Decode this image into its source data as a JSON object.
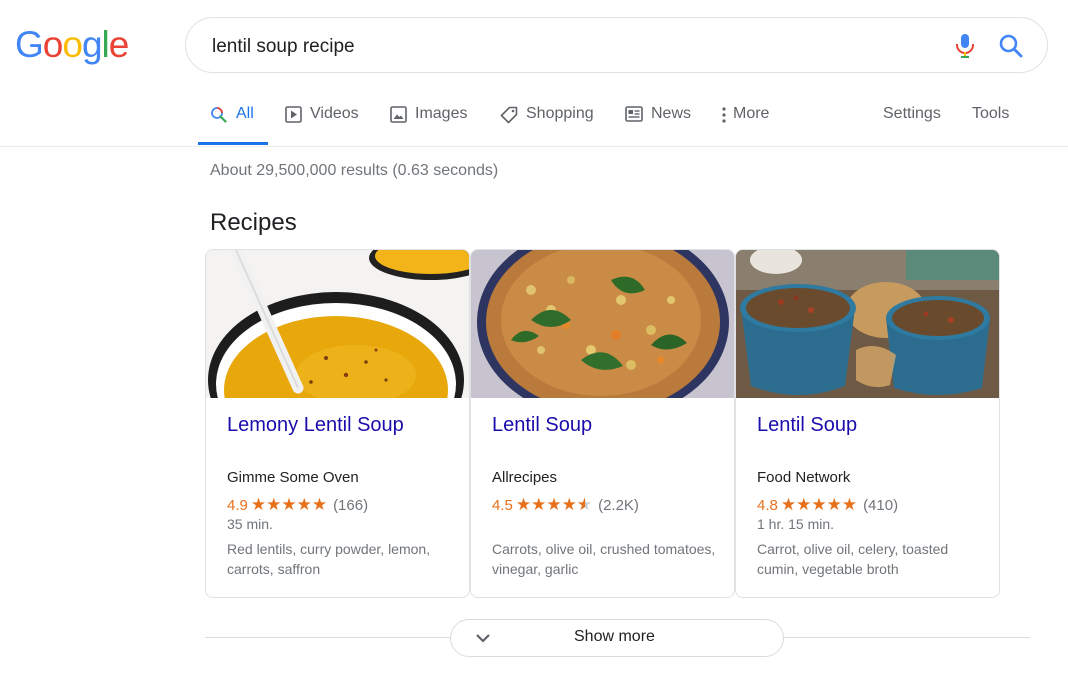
{
  "logo": {
    "letters": [
      "G",
      "o",
      "o",
      "g",
      "l",
      "e"
    ],
    "colors": [
      "#4285F4",
      "#EA4335",
      "#FBBC05",
      "#4285F4",
      "#34A853",
      "#EA4335"
    ]
  },
  "search": {
    "query": "lentil soup recipe",
    "mic_icon": "mic-icon",
    "search_icon": "search-icon"
  },
  "tabs": [
    {
      "label": "All",
      "icon": "search-icon",
      "active": true
    },
    {
      "label": "Videos",
      "icon": "play-icon"
    },
    {
      "label": "Images",
      "icon": "image-icon"
    },
    {
      "label": "Shopping",
      "icon": "tag-icon"
    },
    {
      "label": "News",
      "icon": "news-icon"
    },
    {
      "label": "More",
      "icon": "more-vert-icon"
    },
    {
      "label": "Settings"
    },
    {
      "label": "Tools"
    }
  ],
  "results": {
    "stats": "About 29,500,000 results (0.63 seconds)"
  },
  "recipes": {
    "section_title": "Recipes",
    "cards": [
      {
        "title": "Lemony Lentil Soup",
        "source": "Gimme Some Oven",
        "rating": "4.9",
        "stars": "★★★★★",
        "reviews": "(166)",
        "time": "35 min.",
        "ingredients": "Red lentils, curry powder, lemon, carrots, saffron"
      },
      {
        "title": "Lentil Soup",
        "source": "Allrecipes",
        "rating": "4.5",
        "stars": "★★★★★",
        "reviews": "(2.2K)",
        "time": "",
        "ingredients": "Carrots, olive oil, crushed tomatoes, vinegar, garlic"
      },
      {
        "title": "Lentil Soup",
        "source": "Food Network",
        "rating": "4.8",
        "stars": "★★★★★",
        "reviews": "(410)",
        "time": "1 hr. 15 min.",
        "ingredients": "Carrot, olive oil, celery, toasted cumin, vegetable broth"
      }
    ]
  },
  "show_more": {
    "label": "Show more"
  },
  "colors": {
    "link": "#1a0dab",
    "accent": "#1a73e8",
    "star": "#e7711b"
  }
}
